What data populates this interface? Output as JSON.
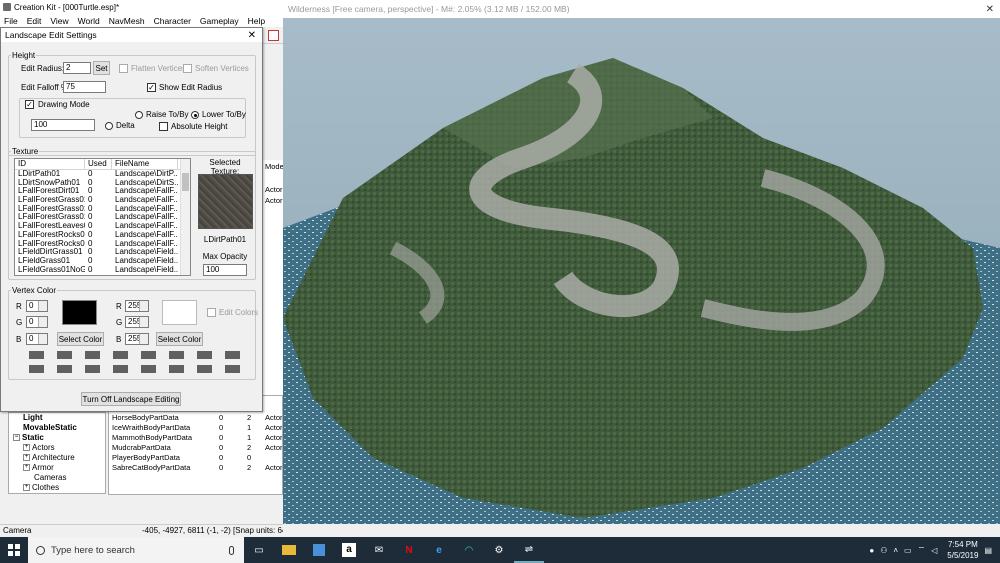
{
  "app": {
    "title": "Creation Kit - [000Turtle.esp]*",
    "menu": [
      "File",
      "Edit",
      "View",
      "World",
      "NavMesh",
      "Character",
      "Gameplay",
      "Help"
    ]
  },
  "dialog": {
    "title": "Landscape Edit Settings",
    "height_group": "Height",
    "edit_radius_label": "Edit Radius:",
    "edit_radius_value": "2",
    "set_button": "Set",
    "flatten_vertices": "Flatten Vertices",
    "soften_vertices": "Soften Vertices",
    "edit_falloff_label": "Edit Falloff %:",
    "edit_falloff_value": "75",
    "show_edit_radius": "Show Edit Radius",
    "drawing_mode": "Drawing Mode",
    "drawing_value": "100",
    "raise_to_by": "Raise To/By",
    "lower_to_by": "Lower To/By",
    "delta": "Delta",
    "absolute_height": "Absolute Height",
    "texture_group": "Texture",
    "tex_columns": [
      "ID",
      "Used",
      "FileName"
    ],
    "textures": [
      {
        "id": "LDirtPath01",
        "used": "0",
        "file": "Landscape\\DirtP..."
      },
      {
        "id": "LDirtSnowPath01",
        "used": "0",
        "file": "Landscape\\DirtS..."
      },
      {
        "id": "LFallForestDirt01",
        "used": "0",
        "file": "Landscape\\FallF..."
      },
      {
        "id": "LFallForestGrass01",
        "used": "0",
        "file": "Landscape\\FallF..."
      },
      {
        "id": "LFallForestGrass01...",
        "used": "0",
        "file": "Landscape\\FallF..."
      },
      {
        "id": "LFallForestGrass01...",
        "used": "0",
        "file": "Landscape\\FallF..."
      },
      {
        "id": "LFallForestLeaves01",
        "used": "0",
        "file": "Landscape\\FallF..."
      },
      {
        "id": "LFallForestRocks01",
        "used": "0",
        "file": "Landscape\\FallF..."
      },
      {
        "id": "LFallForestRocks01...",
        "used": "0",
        "file": "Landscape\\FallF..."
      },
      {
        "id": "LFieldDirtGrass01",
        "used": "0",
        "file": "Landscape\\Field..."
      },
      {
        "id": "LFieldGrass01",
        "used": "0",
        "file": "Landscape\\Field..."
      },
      {
        "id": "LFieldGrass01NoGr...",
        "used": "0",
        "file": "Landscape\\Field..."
      }
    ],
    "selected_texture_label": "Selected Texture:",
    "selected_texture_name": "LDirtPath01",
    "max_opacity_label": "Max Opacity",
    "max_opacity_value": "100",
    "vertex_color_group": "Vertex Color",
    "left_color": {
      "r": "0",
      "g": "0",
      "b": "0"
    },
    "right_color": {
      "r": "255",
      "g": "255",
      "b": "255"
    },
    "select_color": "Select Color",
    "edit_colors": "Edit Colors",
    "turn_off_button": "Turn Off Landscape Editing"
  },
  "object_window": {
    "tree": [
      "Light",
      "MovableStatic",
      "Static",
      "Actors",
      "Architecture",
      "Armor",
      "Cameras",
      "Clothes"
    ],
    "rows": [
      {
        "name": "HorseBodyPartData",
        "c1": "0",
        "c2": "2",
        "c3": "Actor"
      },
      {
        "name": "IceWraithBodyPartData",
        "c1": "0",
        "c2": "1",
        "c3": "Actor"
      },
      {
        "name": "MammothBodyPartData",
        "c1": "0",
        "c2": "1",
        "c3": "Actor"
      },
      {
        "name": "MudcrabPartData",
        "c1": "0",
        "c2": "2",
        "c3": "Actor"
      },
      {
        "name": "PlayerBodyPartData",
        "c1": "0",
        "c2": "0",
        "c3": ""
      },
      {
        "name": "SabreCatBodyPartData",
        "c1": "0",
        "c2": "2",
        "c3": "Actor"
      }
    ],
    "side_headers": [
      "Mode",
      "Actor",
      "Actor"
    ]
  },
  "viewport": {
    "title": "Wilderness [Free camera, perspective] - M#: 2.05% (3.12 MB / 152.00 MB)"
  },
  "status": {
    "left": "Camera",
    "coords": "-405, -4927, 6811 (-1, -2) [Snap units: 64] ["
  },
  "taskbar": {
    "search_placeholder": "Type here to search",
    "time": "7:54 PM",
    "date": "5/5/2019"
  }
}
